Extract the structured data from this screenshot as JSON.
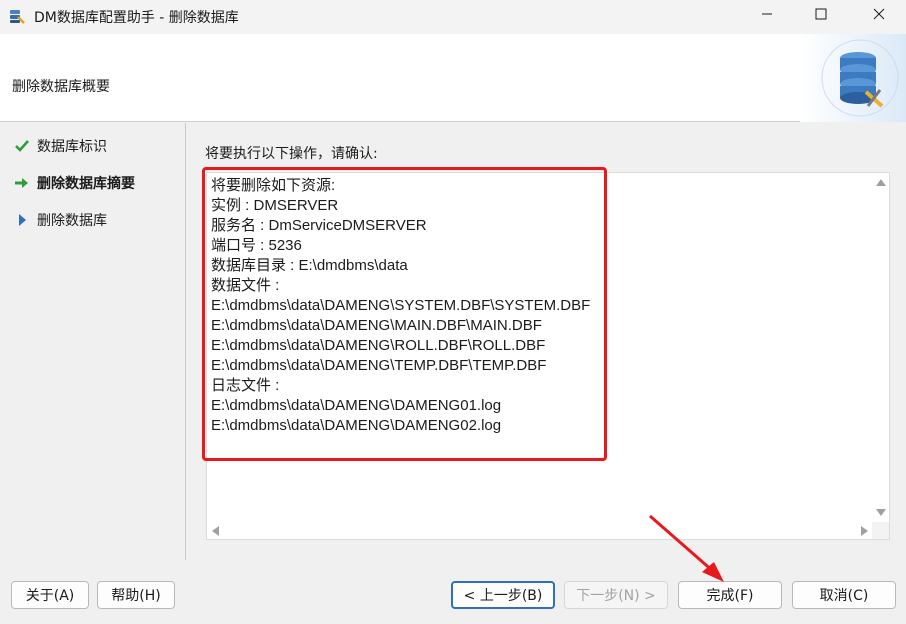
{
  "window": {
    "title": "DM数据库配置助手 - 删除数据库",
    "minimize": "minimize",
    "maximize": "maximize",
    "close": "close"
  },
  "header": {
    "title": "删除数据库概要",
    "art_icon": "database-settings-icon"
  },
  "sidebar": {
    "items": [
      {
        "label": "数据库标识",
        "icon": "check-icon",
        "state": "done"
      },
      {
        "label": "删除数据库摘要",
        "icon": "arrow-right-icon",
        "state": "current"
      },
      {
        "label": "删除数据库",
        "icon": "triangle-right-icon",
        "state": "pending"
      }
    ]
  },
  "main": {
    "instruction": "将要执行以下操作，请确认:",
    "lines": [
      "将要删除如下资源:",
      "实例 : DMSERVER",
      "服务名 : DmServiceDMSERVER",
      "端口号 : 5236",
      "数据库目录 : E:\\dmdbms\\data",
      "数据文件 :",
      "E:\\dmdbms\\data\\DAMENG\\SYSTEM.DBF\\SYSTEM.DBF",
      "E:\\dmdbms\\data\\DAMENG\\MAIN.DBF\\MAIN.DBF",
      "E:\\dmdbms\\data\\DAMENG\\ROLL.DBF\\ROLL.DBF",
      "E:\\dmdbms\\data\\DAMENG\\TEMP.DBF\\TEMP.DBF",
      "日志文件 :",
      "E:\\dmdbms\\data\\DAMENG\\DAMENG01.log",
      "E:\\dmdbms\\data\\DAMENG\\DAMENG02.log"
    ]
  },
  "buttons": {
    "about": "关于(A)",
    "help": "帮助(H)",
    "back": "< 上一步(B)",
    "next": "下一步(N) >",
    "finish": "完成(F)",
    "cancel": "取消(C)"
  },
  "colors": {
    "highlight": "#e8191c",
    "check": "#2e9e3a",
    "arrow": "#2e9e3a",
    "pending": "#2f6fbf"
  }
}
